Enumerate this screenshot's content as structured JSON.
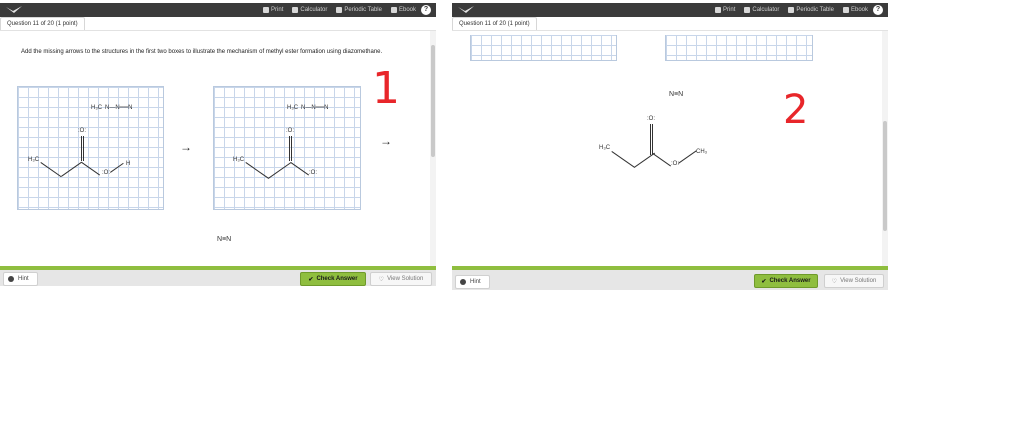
{
  "toolbar": {
    "print": "Print",
    "calculator": "Calculator",
    "periodic_table": "Periodic Table",
    "ebook": "Ebook",
    "help": "?"
  },
  "question": {
    "tab_label": "Question 11 of 20 (1 point)",
    "text": "Add the missing arrows to the structures in the first two boxes to illustrate the mechanism of methyl ester formation using diazomethane."
  },
  "molecules": {
    "h3c": "H₃C",
    "ch3": "CH₃",
    "n2_link": "N—N══N",
    "n_triple_n": "N≡N",
    "oxygen": ":O:",
    "h": "H",
    "o_minus": ":O:"
  },
  "annotations": {
    "step1": "1",
    "step2": "2"
  },
  "buttons": {
    "hint": "Hint",
    "check_answer": "Check Answer",
    "view_solution": "View Solution"
  },
  "colors": {
    "toolbar_bg": "#3b3b3b",
    "accent_green": "#8fbe3f",
    "grid_line": "#c8d6ea",
    "annotation_red": "#e8262a"
  }
}
